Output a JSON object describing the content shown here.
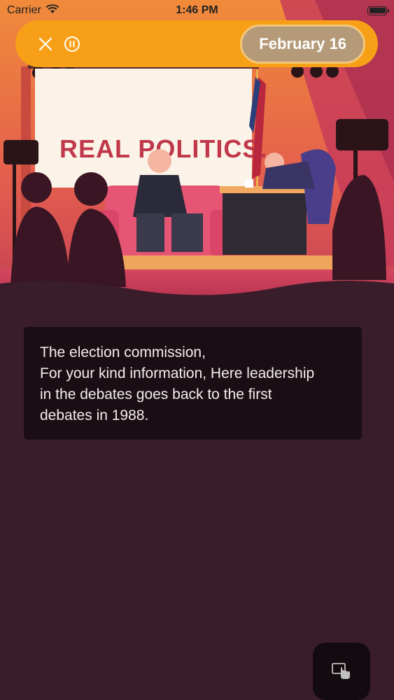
{
  "status_bar": {
    "carrier": "Carrier",
    "time": "1:46 PM"
  },
  "header": {
    "date": "February 16",
    "close_icon": "close-icon",
    "pause_icon": "pause-circle-icon"
  },
  "hero": {
    "sign_text": "REAL POLITICS."
  },
  "story": {
    "lines": [
      "The election commission,",
      "For your kind information, Here leadership",
      "in the debates goes back to the first",
      "debates in 1988."
    ]
  },
  "floating_button": {
    "icon": "tap-screen-icon"
  },
  "colors": {
    "accent": "#f7a017",
    "background": "#3a1d2a",
    "card": "#1a0e14",
    "date_chip": "#b49a78"
  }
}
